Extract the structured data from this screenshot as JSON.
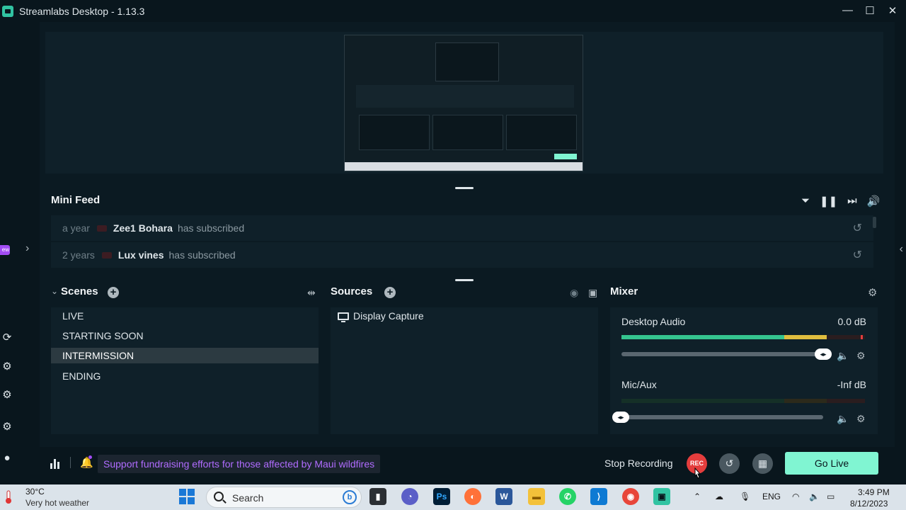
{
  "window": {
    "title": "Streamlabs Desktop - 1.13.3",
    "minimize": "—",
    "maximize": "☐",
    "close": "✕"
  },
  "left_rail": {
    "new_badge": "ew"
  },
  "mini_feed": {
    "title": "Mini Feed",
    "events": [
      {
        "time": "a year",
        "name": "Zee1 Bohara",
        "action": "has subscribed"
      },
      {
        "time": "2 years",
        "name": "Lux vines",
        "action": "has subscribed"
      }
    ]
  },
  "scenes": {
    "title": "Scenes",
    "items": [
      "LIVE",
      "STARTING SOON",
      "INTERMISSION",
      "ENDING"
    ],
    "active": "INTERMISSION"
  },
  "sources": {
    "title": "Sources",
    "items": [
      "Display Capture"
    ]
  },
  "mixer": {
    "title": "Mixer",
    "channels": [
      {
        "name": "Desktop Audio",
        "level": "0.0 dB",
        "volume": 1.0
      },
      {
        "name": "Mic/Aux",
        "level": "-Inf dB",
        "volume": 0.0
      }
    ]
  },
  "footer": {
    "notice": "Support fundraising efforts for those affected by Maui wildfires",
    "stop_recording": "Stop Recording",
    "rec": "REC",
    "go_live": "Go Live"
  },
  "taskbar": {
    "temperature": "30°C",
    "weather": "Very hot weather",
    "search_placeholder": "Search",
    "language": "ENG",
    "time": "3:49 PM",
    "date": "8/12/2023"
  },
  "colors": {
    "accent_go_live": "#80f5d2",
    "rec_red": "#e43d3d",
    "notice_purple": "#b06cff",
    "app_background": "#09161d"
  },
  "icons": [
    "filter-icon",
    "pause-icon",
    "skip-icon",
    "volume-icon",
    "replay-icon",
    "settings-icon",
    "add-icon",
    "monitor-icon",
    "microphone-icon"
  ]
}
